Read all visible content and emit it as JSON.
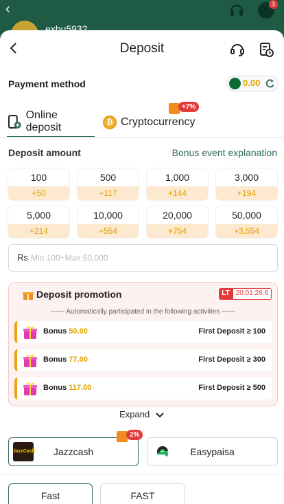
{
  "background": {
    "username": "exbu5932",
    "chat_badge": "3"
  },
  "header": {
    "title": "Deposit"
  },
  "payment_method": {
    "label": "Payment method",
    "balance": "0.00"
  },
  "tabs": [
    {
      "label": "Online deposit",
      "active": true
    },
    {
      "label": "Cryptocurrency",
      "badge": "+7%"
    }
  ],
  "deposit": {
    "label": "Deposit amount",
    "bonus_link": "Bonus event explanation",
    "amounts": [
      {
        "value": "100",
        "bonus": "+50"
      },
      {
        "value": "500",
        "bonus": "+117"
      },
      {
        "value": "1,000",
        "bonus": "+144"
      },
      {
        "value": "3,000",
        "bonus": "+194"
      },
      {
        "value": "5,000",
        "bonus": "+214"
      },
      {
        "value": "10,000",
        "bonus": "+554"
      },
      {
        "value": "20,000",
        "bonus": "+754"
      },
      {
        "value": "50,000",
        "bonus": "+3,554"
      }
    ],
    "currency_symbol": "Rs",
    "input_placeholder": "Min 100~Max 50,000",
    "input_value": ""
  },
  "promotion": {
    "title": "Deposit promotion",
    "timer_label": "LT",
    "timer": "20:01:26.6",
    "auto_text": "------ Automatically participated in the following activities ------",
    "rows": [
      {
        "label": "Bonus",
        "value": "50.00",
        "requirement": "First Deposit ≥ 100"
      },
      {
        "label": "Bonus",
        "value": "77.00",
        "requirement": "First Deposit ≥ 300"
      },
      {
        "label": "Bonus",
        "value": "117.00",
        "requirement": "First Deposit ≥ 500"
      }
    ],
    "expand_label": "Expand"
  },
  "channels": [
    {
      "label": "Jazzcash",
      "badge": "2%",
      "selected": true,
      "logo_text": "JazzCash"
    },
    {
      "label": "Easypaisa",
      "selected": false
    }
  ],
  "speed_options": [
    {
      "label": "Fast",
      "selected": true
    },
    {
      "label": "FAST",
      "selected": false
    }
  ],
  "colors": {
    "brand": "#2d6b55",
    "accent": "#e0a000",
    "bonus_bg": "#fde9cf",
    "badge_red": "#e23b3b"
  }
}
